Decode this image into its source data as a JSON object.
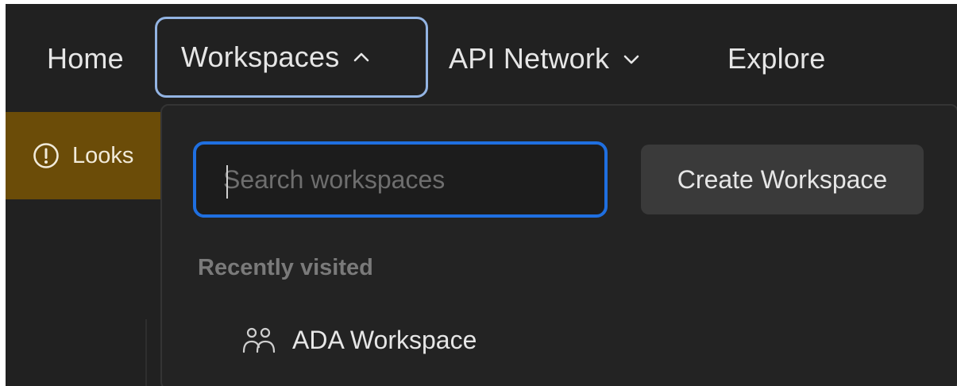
{
  "nav": {
    "items": [
      {
        "label": "Home"
      },
      {
        "label": "Workspaces",
        "icon": "chevron-up-icon",
        "active": true
      },
      {
        "label": "API Network",
        "icon": "chevron-down-icon"
      },
      {
        "label": "Explore"
      }
    ]
  },
  "banner": {
    "icon": "alert-circle-icon",
    "text": "Looks",
    "color": "#6b4c08"
  },
  "dropdown": {
    "search": {
      "placeholder": "Search workspaces",
      "value": ""
    },
    "create_button_label": "Create Workspace",
    "recent_label": "Recently visited",
    "workspaces": [
      {
        "icon": "team-icon",
        "name": "ADA Workspace"
      }
    ]
  },
  "colors": {
    "background": "#212121",
    "accent_focus": "#1f6fe0",
    "active_nav_border": "#93b4e3",
    "button_bg": "#3a3a3a"
  }
}
